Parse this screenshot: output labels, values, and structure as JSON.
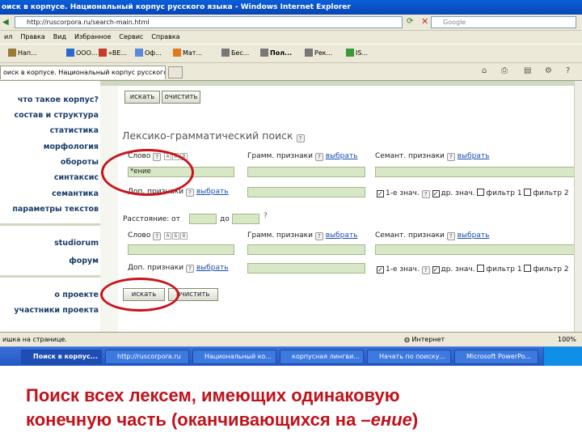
{
  "window": {
    "title": "оиск в корпусе. Национальный корпус русского языка - Windows Internet Explorer",
    "address": "http://ruscorpora.ru/search-main.html",
    "search_engine": "Google"
  },
  "menu": [
    "ил",
    "Правка",
    "Вид",
    "Избранное",
    "Сервис",
    "Справка"
  ],
  "links": [
    "Нап...",
    "ООО...",
    "«ВЕ...",
    "Оф...",
    "Мат...",
    "Бес...",
    "Пол...",
    "Рек...",
    "IS..."
  ],
  "tab": {
    "label": "оиск в корпусе. Национальный корпус русского ..."
  },
  "nav": {
    "items": [
      "что такое корпус?",
      "состав и структура",
      "статистика",
      "морфология",
      "обороты",
      "синтаксис",
      "семантика",
      "параметры текстов"
    ],
    "items2": [
      "studiorum",
      "форум"
    ],
    "items3": [
      "о проекте",
      "участники проекта"
    ]
  },
  "form": {
    "search_label": "искать",
    "clear_label": "очистить",
    "heading": "Лексико-грамматический поиск",
    "word_label": "Слово",
    "gram_label": "Грамм. признаки",
    "sem_label": "Семант. признаки",
    "extra_label": "Доп. признаки",
    "choose_label": "выбрать",
    "word_value": "*ение",
    "opt1": "1-е знач.",
    "opt2": "др. знач.",
    "opt3": "фильтр 1",
    "opt4": "фильтр 2",
    "distance_label": "Расстояние: от",
    "to_label": "до",
    "help": "?",
    "keys": "А Б В"
  },
  "statusbar": {
    "left": "ишка на странице.",
    "zone": "Интернет",
    "zoom": "100%"
  },
  "taskbar": {
    "items": [
      "Поиск в корпус...",
      "http://ruscorpora.ru",
      "Национальный ко...",
      "корпусная лингви...",
      "Начать по поиску...",
      "Microsoft PowerPo..."
    ]
  },
  "caption": {
    "line1": "Поиск всех лексем, имеющих одинаковую",
    "line2": "конечную часть (оканчивающихся на –",
    "italic": "ение",
    "tail": ")"
  },
  "colors": {
    "annotation": "#c8141c",
    "field": "#d8e7c5",
    "nav_text": "#1a3d6b",
    "link": "#1b4fb0"
  }
}
